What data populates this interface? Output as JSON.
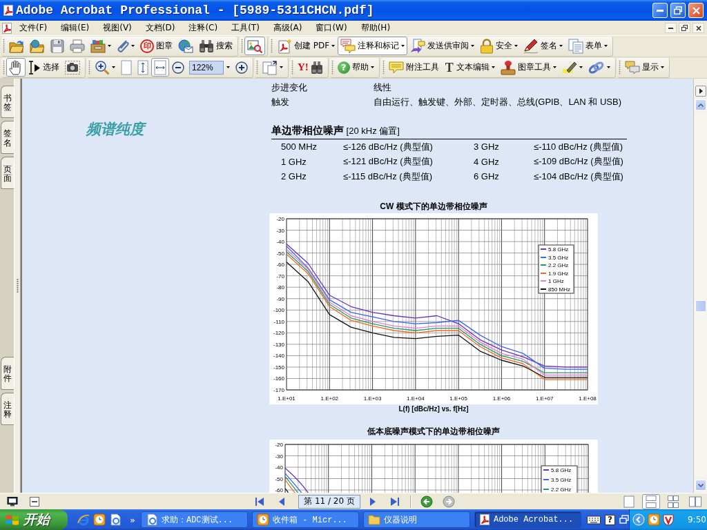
{
  "window": {
    "title": "Adobe Acrobat Professional - [5989-5311CHCN.pdf]"
  },
  "menu_bar": {
    "items": [
      {
        "label": "文件(F)"
      },
      {
        "label": "编辑(E)"
      },
      {
        "label": "视图(V)"
      },
      {
        "label": "文档(D)"
      },
      {
        "label": "注释(C)"
      },
      {
        "label": "工具(T)"
      },
      {
        "label": "高级(A)"
      },
      {
        "label": "窗口(W)"
      },
      {
        "label": "帮助(H)"
      }
    ]
  },
  "toolbars": [
    {
      "groups": [
        {
          "items": [
            {
              "kind": "button",
              "dropdown": false,
              "selected": false
            },
            {
              "kind": "button",
              "dropdown": false,
              "selected": false
            },
            {
              "kind": "button",
              "dropdown": false,
              "selected": false
            },
            {
              "kind": "button",
              "dropdown": false,
              "selected": false
            },
            {
              "kind": "button",
              "dropdown": true,
              "selected": false
            },
            {
              "kind": "button",
              "dropdown": true,
              "selected": false
            },
            {
              "kind": "button",
              "glyph": "印",
              "label": "图章",
              "dropdown": false,
              "selected": false
            },
            {
              "kind": "button",
              "dropdown": false,
              "selected": false
            },
            {
              "kind": "button",
              "label": "搜索",
              "dropdown": false,
              "selected": false
            }
          ]
        },
        {
          "items": [
            {
              "kind": "button",
              "dropdown": false,
              "selected": true
            }
          ]
        },
        {
          "items": [
            {
              "kind": "button",
              "label": "创建 PDF",
              "dropdown": true,
              "selected": false
            },
            {
              "kind": "button",
              "label": "注释和标记",
              "dropdown": true,
              "selected": true
            },
            {
              "kind": "button",
              "label": "发送供审阅",
              "dropdown": true,
              "selected": false
            },
            {
              "kind": "button",
              "label": "安全",
              "dropdown": true,
              "selected": false
            },
            {
              "kind": "button",
              "label": "签名",
              "dropdown": true,
              "selected": false
            },
            {
              "kind": "button",
              "label": "表单",
              "dropdown": true,
              "selected": false
            }
          ]
        }
      ]
    },
    {
      "groups": [
        {
          "items": [
            {
              "kind": "button",
              "dropdown": false,
              "selected": true
            },
            {
              "kind": "button",
              "label": "选择",
              "dropdown": false,
              "selected": false
            },
            {
              "kind": "button",
              "dropdown": false,
              "selected": false
            }
          ]
        },
        {
          "items": [
            {
              "kind": "button",
              "dropdown": true,
              "selected": false
            },
            {
              "kind": "button",
              "dropdown": false,
              "selected": false
            },
            {
              "kind": "button",
              "dropdown": false,
              "selected": false
            },
            {
              "kind": "button",
              "dropdown": false,
              "selected": true
            },
            {
              "kind": "button",
              "dropdown": false,
              "selected": false
            },
            {
              "kind": "field",
              "value": "122%",
              "dropdown": true
            },
            {
              "kind": "button",
              "dropdown": false,
              "selected": false
            }
          ]
        },
        {
          "items": [
            {
              "kind": "button",
              "dropdown": true,
              "selected": false
            }
          ]
        },
        {
          "items": [
            {
              "kind": "button",
              "glyph": "Y!",
              "dropdown": false,
              "selected": false
            }
          ]
        },
        {
          "items": [
            {
              "kind": "button",
              "glyph": "?",
              "label": "帮助",
              "dropdown": true,
              "selected": false
            }
          ]
        },
        {
          "items": [
            {
              "kind": "button",
              "label": "附注工具",
              "dropdown": false,
              "selected": false
            },
            {
              "kind": "button",
              "glyph": "T",
              "label": "文本编辑",
              "dropdown": true,
              "selected": false
            },
            {
              "kind": "button",
              "label": "图章工具",
              "dropdown": true,
              "selected": false
            },
            {
              "kind": "button",
              "dropdown": true,
              "selected": false
            },
            {
              "kind": "button",
              "dropdown": true,
              "selected": false
            }
          ]
        },
        {
          "items": [
            {
              "kind": "button",
              "label": "显示",
              "dropdown": true,
              "selected": false
            }
          ]
        }
      ]
    }
  ],
  "sidebar": {
    "top_tabs": [
      {
        "label": "书签",
        "selected": false
      },
      {
        "label": "签名",
        "selected": false
      },
      {
        "label": "页面",
        "selected": false
      }
    ],
    "bottom_tabs": [
      {
        "label": "附件",
        "selected": false
      },
      {
        "label": "注释",
        "selected": false
      }
    ]
  },
  "document": {
    "spec_rows": [
      {
        "label": "步进变化",
        "value": "线性"
      },
      {
        "label": "触发",
        "value": "自由运行、触发键、外部、定时器、总线(GPIB、LAN 和 USB)"
      }
    ],
    "section_title": "频谱纯度",
    "table": {
      "title": "**单边带相位噪声** [20 kHz 偏置]",
      "rows": [
        [
          "500 MHz",
          "≤-126 dBc/Hz (典型值)",
          "3 GHz",
          "≤-110 dBc/Hz (典型值)"
        ],
        [
          "1 GHz",
          "≤-121 dBc/Hz (典型值)",
          "4 GHz",
          "≤-109 dBc/Hz (典型值)"
        ],
        [
          "2 GHz",
          "≤-115 dBc/Hz (典型值)",
          "6 GHz",
          "≤-104 dBc/Hz (典型值)"
        ]
      ]
    },
    "charts": [
      {
        "chart_data": {
          "type": "line",
          "title": "CW 模式下的单边带相位噪声",
          "xlabel": "L(f) [dBc/Hz] vs. f[Hz]",
          "grid": true,
          "legend": true,
          "categories": [
            "1.E+01",
            null,
            "1.E+02",
            null,
            "1.E+03",
            null,
            "1.E+04",
            null,
            "1.E+05",
            null,
            "1.E+06",
            null,
            "1.E+07",
            null,
            "1.E+08"
          ],
          "series": [
            {
              "name": "5.8 GHz",
              "color": "#6a2fc0",
              "values": [
                -42,
                -59,
                -87,
                -97,
                -102,
                -105,
                -107,
                -105,
                -112,
                -126,
                -135,
                -141,
                -149,
                -150,
                -150
              ]
            },
            {
              "name": "3.5 GHz",
              "color": "#3a64f0",
              "values": [
                -44,
                -63,
                -91,
                -102,
                -106,
                -110,
                -112,
                -111,
                -109,
                -122,
                -132,
                -138,
                -151,
                -152,
                -152
              ]
            },
            {
              "name": "2.2 GHz",
              "color": "#1f9a6a",
              "values": [
                -49,
                -66,
                -95,
                -107,
                -112,
                -116,
                -118,
                -116,
                -116,
                -130,
                -140,
                -145,
                -155,
                -155,
                -155
              ]
            },
            {
              "name": "1.9 GHz",
              "color": "#f06a20",
              "values": [
                -51,
                -68,
                -97,
                -109,
                -114,
                -118,
                -120,
                -118,
                -118,
                -132,
                -142,
                -147,
                -161,
                -161,
                -161
              ]
            },
            {
              "name": "1 GHz",
              "color": "#e07fc8",
              "values": [
                -47,
                -64,
                -93,
                -105,
                -110,
                -114,
                -116,
                -114,
                -114,
                -128,
                -138,
                -143,
                -157,
                -157,
                -157
              ]
            },
            {
              "name": "850 MHz",
              "color": "#111111",
              "values": [
                -58,
                -75,
                -104,
                -115,
                -120,
                -124,
                -125,
                -123,
                -122,
                -136,
                -144,
                -149,
                -159,
                -159,
                -159
              ]
            }
          ],
          "ylim": [
            -170,
            -20
          ],
          "yticks": [
            -20,
            -30,
            -40,
            -50,
            -60,
            -70,
            -80,
            -90,
            -100,
            -110,
            -120,
            -130,
            -140,
            -150,
            -160,
            -170
          ]
        }
      }
    ],
    "chart_picture": {
      "title": "低本底噪声模式下的单边带相位噪声",
      "y_labels": [
        "-20",
        "-30",
        "-40",
        "-50",
        "-60"
      ],
      "legend": [
        {
          "name": "5.8 GHz",
          "color": "#6a2fc0"
        },
        {
          "name": "3.5 GHz",
          "color": "#3a64f0"
        },
        {
          "name": "2.2 GHz",
          "color": "#1f9a6a"
        }
      ]
    }
  },
  "status_bar": {
    "page_field": "第 11 / 20 页",
    "layout_buttons": [
      {
        "selected": false
      },
      {
        "selected": true
      },
      {
        "selected": false
      },
      {
        "selected": false
      }
    ]
  },
  "taskbar": {
    "start": "开始",
    "more": "»",
    "tasks": [
      {
        "label": "求助：ADC测试...",
        "selected": false
      },
      {
        "label": "收件箱 - Micr...",
        "selected": false
      },
      {
        "label": "仪器说明",
        "selected": false
      },
      {
        "label": "Adobe Acrobat...",
        "selected": true
      }
    ],
    "help_glyph": "?",
    "clock": "9:50"
  }
}
